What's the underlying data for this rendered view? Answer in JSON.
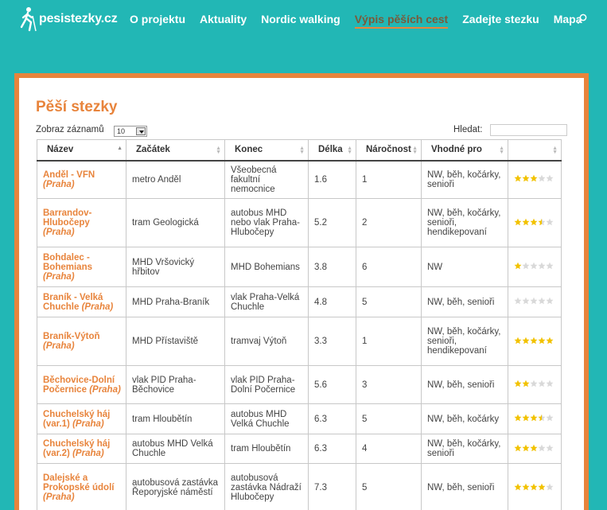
{
  "header": {
    "logo_text": "pesistezky.cz",
    "nav": [
      {
        "label": "O projektu",
        "active": false
      },
      {
        "label": "Aktuality",
        "active": false
      },
      {
        "label": "Nordic walking",
        "active": false
      },
      {
        "label": "Výpis pěších cest",
        "active": true
      },
      {
        "label": "Zadejte stezku",
        "active": false
      },
      {
        "label": "Mapa",
        "active": false
      }
    ]
  },
  "page": {
    "title": "Pěší stezky",
    "length_label": "Zobraz záznamů",
    "length_value": "10",
    "search_label": "Hledat:",
    "search_value": ""
  },
  "table": {
    "columns": [
      "Název",
      "Začátek",
      "Konec",
      "Délka",
      "Náročnost",
      "Vhodné pro",
      ""
    ],
    "rows": [
      {
        "name": "Anděl - VFN",
        "city": "(Praha)",
        "start": "metro Anděl",
        "end": "Všeobecná fakultní nemocnice",
        "length": "1.6",
        "difficulty": "1",
        "suitable": "NW, běh, kočárky, senioři",
        "rating": 3
      },
      {
        "name": "Barrandov-Hlubočepy",
        "city": "(Praha)",
        "start": "tram Geologická",
        "end": "autobus MHD nebo vlak Praha-Hlubočepy",
        "length": "5.2",
        "difficulty": "2",
        "suitable": "NW, běh, kočárky, senioři, hendikepovaní",
        "rating": 3.5
      },
      {
        "name": "Bohdalec - Bohemians",
        "city": "(Praha)",
        "start": "MHD Vršovický hřbitov",
        "end": "MHD Bohemians",
        "length": "3.8",
        "difficulty": "6",
        "suitable": "NW",
        "rating": 1
      },
      {
        "name": "Braník - Velká Chuchle",
        "city": "(Praha)",
        "start": "MHD Praha-Braník",
        "end": "vlak Praha-Velká Chuchle",
        "length": "4.8",
        "difficulty": "5",
        "suitable": "NW, běh, senioři",
        "rating": 0
      },
      {
        "name": "Braník-Výtoň",
        "city": "(Praha)",
        "start": "MHD Přístaviště",
        "end": "tramvaj Výtoň",
        "length": "3.3",
        "difficulty": "1",
        "suitable": "NW, běh, kočárky, senioři, hendikepovaní",
        "rating": 5
      },
      {
        "name": "Běchovice-Dolní Počernice",
        "city": "(Praha)",
        "start": "vlak PID Praha-Běchovice",
        "end": "vlak PID Praha-Dolní Počernice",
        "length": "5.6",
        "difficulty": "3",
        "suitable": "NW, běh, senioři",
        "rating": 2
      },
      {
        "name": "Chuchelský háj (var.1)",
        "city": "(Praha)",
        "start": "tram Hloubětín",
        "end": "autobus MHD Velká Chuchle",
        "length": "6.3",
        "difficulty": "5",
        "suitable": "NW, běh, kočárky",
        "rating": 3.5
      },
      {
        "name": "Chuchelský háj (var.2)",
        "city": "(Praha)",
        "start": "autobus MHD Velká Chuchle",
        "end": "tram Hloubětín",
        "length": "6.3",
        "difficulty": "4",
        "suitable": "NW, běh, kočárky, senioři",
        "rating": 3
      },
      {
        "name": "Dalejské a Prokopské údolí",
        "city": "(Praha)",
        "start": "autobusová zastávka Řeporyjské náměstí",
        "end": "autobusová zastávka Nádraží Hlubočepy",
        "length": "7.3",
        "difficulty": "5",
        "suitable": "NW, běh, senioři",
        "rating": 4
      }
    ]
  },
  "colors": {
    "teal": "#22b7b5",
    "orange": "#e8843c",
    "star_fill": "#f2c200",
    "star_empty": "#d9d9d9"
  }
}
